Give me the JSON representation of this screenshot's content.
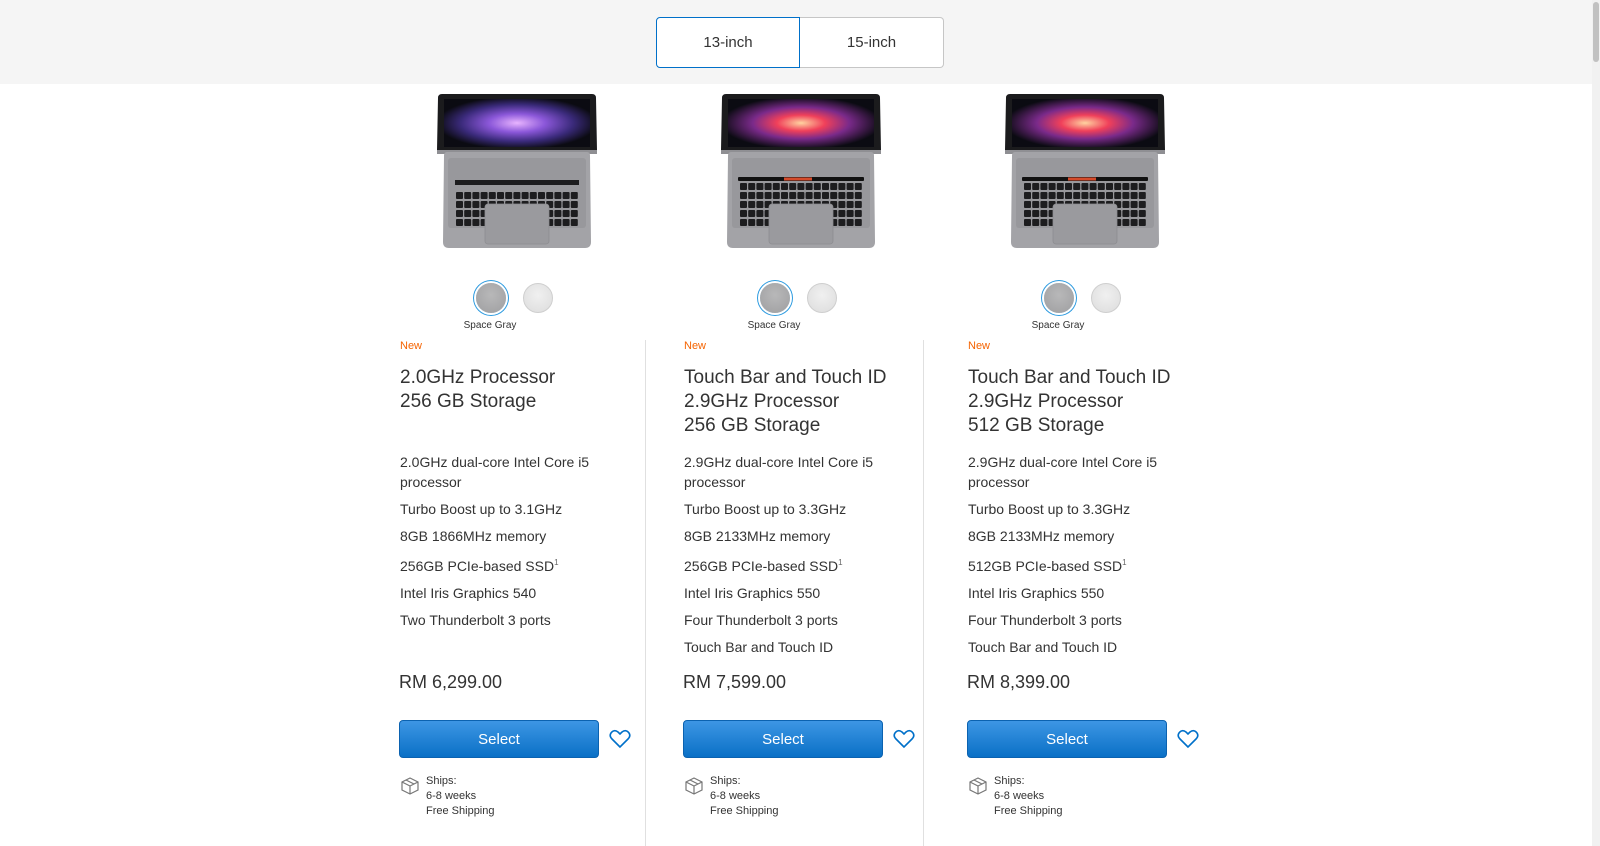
{
  "size_toggle": {
    "options": [
      "13-inch",
      "15-inch"
    ],
    "selected": "13-inch"
  },
  "products": [
    {
      "color_label": "Space Gray",
      "badge": "New",
      "title_lines": [
        "2.0GHz Processor",
        "256 GB Storage"
      ],
      "specs": [
        "2.0GHz dual-core Intel Core i5 processor",
        "Turbo Boost up to 3.1GHz",
        "8GB 1866MHz memory",
        "256GB PCIe-based SSD",
        "Intel Iris Graphics 540",
        "Two Thunderbolt 3 ports"
      ],
      "ssd_footnote": "1",
      "price": "RM 6,299.00",
      "select_label": "Select",
      "ships_label": "Ships:",
      "ships_time": "6-8 weeks",
      "shipping": "Free Shipping",
      "screen_style": "purple"
    },
    {
      "color_label": "Space Gray",
      "badge": "New",
      "title_lines": [
        "Touch Bar and Touch ID",
        "2.9GHz Processor",
        "256 GB Storage"
      ],
      "specs": [
        "2.9GHz dual-core Intel Core i5 processor",
        "Turbo Boost up to 3.3GHz",
        "8GB 2133MHz memory",
        "256GB PCIe-based SSD",
        "Intel Iris Graphics 550",
        "Four Thunderbolt 3 ports",
        "Touch Bar and Touch ID"
      ],
      "ssd_footnote": "1",
      "price": "RM 7,599.00",
      "select_label": "Select",
      "ships_label": "Ships:",
      "ships_time": "6-8 weeks",
      "shipping": "Free Shipping",
      "screen_style": "red"
    },
    {
      "color_label": "Space Gray",
      "badge": "New",
      "title_lines": [
        "Touch Bar and Touch ID",
        "2.9GHz Processor",
        "512 GB Storage"
      ],
      "specs": [
        "2.9GHz dual-core Intel Core i5 processor",
        "Turbo Boost up to 3.3GHz",
        "8GB 2133MHz memory",
        "512GB PCIe-based SSD",
        "Intel Iris Graphics 550",
        "Four Thunderbolt 3 ports",
        "Touch Bar and Touch ID"
      ],
      "ssd_footnote": "1",
      "price": "RM 8,399.00",
      "select_label": "Select",
      "ships_label": "Ships:",
      "ships_time": "6-8 weeks",
      "shipping": "Free Shipping",
      "screen_style": "red"
    }
  ],
  "colors": {
    "accent_blue": "#0070c9",
    "badge_orange": "#f56300",
    "space_gray": "#a8a8aa",
    "silver": "#e3e3e3"
  },
  "icons": [
    "box-icon",
    "heart-icon"
  ]
}
